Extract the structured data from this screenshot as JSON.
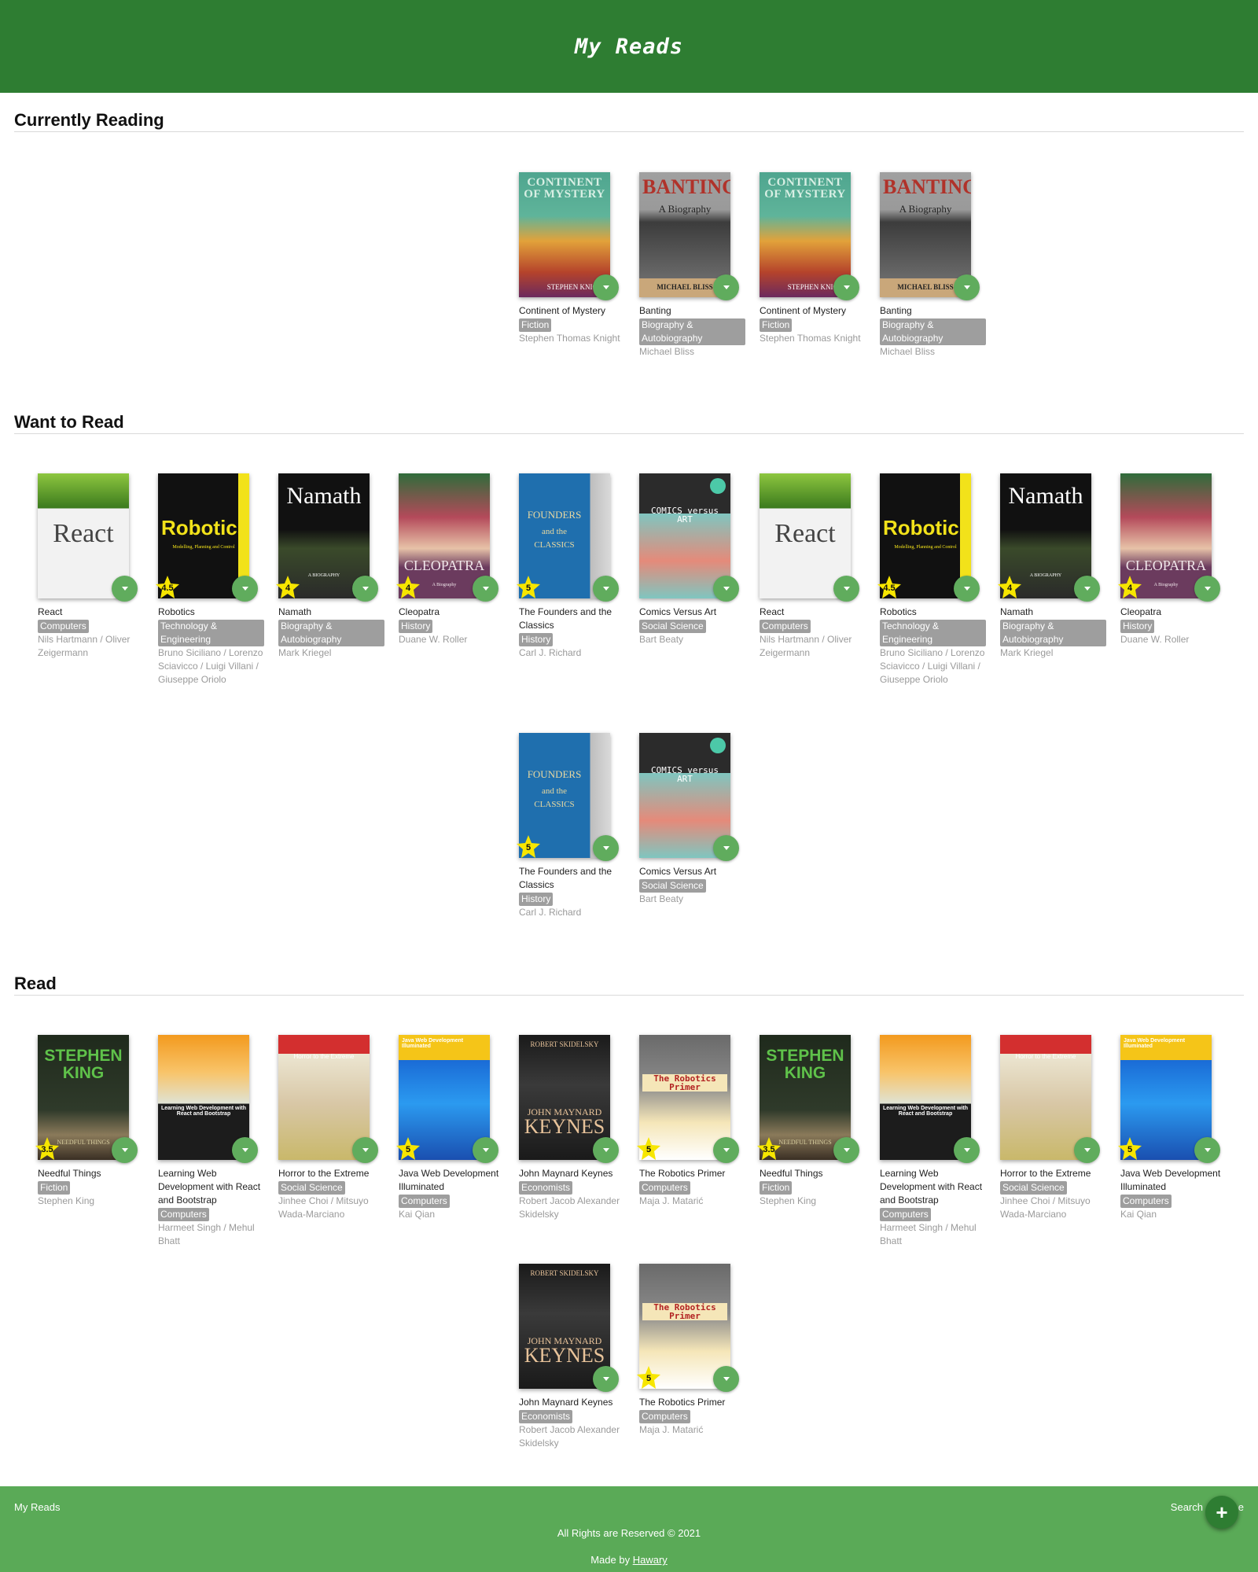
{
  "header": {
    "title": "My Reads"
  },
  "shelves": [
    {
      "title": "Currently Reading",
      "books": [
        {
          "title": "Continent of Mystery",
          "category": "Fiction",
          "author": "Stephen Thomas Knight",
          "cover": "continent",
          "rating": null
        },
        {
          "title": "Banting",
          "category": "Biography & Autobiography",
          "author": "Michael Bliss",
          "cover": "banting",
          "rating": null
        },
        {
          "title": "Continent of Mystery",
          "category": "Fiction",
          "author": "Stephen Thomas Knight",
          "cover": "continent",
          "rating": null
        },
        {
          "title": "Banting",
          "category": "Biography & Autobiography",
          "author": "Michael Bliss",
          "cover": "banting",
          "rating": null
        }
      ]
    },
    {
      "title": "Want to Read",
      "books": [
        {
          "title": "React",
          "category": "Computers",
          "author": "Nils Hartmann / Oliver Zeigermann",
          "cover": "react",
          "rating": null
        },
        {
          "title": "Robotics",
          "category": "Technology & Engineering",
          "author": "Bruno Siciliano / Lorenzo Sciavicco / Luigi Villani / Giuseppe Oriolo",
          "cover": "robotics",
          "rating": "4.5"
        },
        {
          "title": "Namath",
          "category": "Biography & Autobiography",
          "author": "Mark Kriegel",
          "cover": "namath",
          "rating": "4"
        },
        {
          "title": "Cleopatra",
          "category": "History",
          "author": "Duane W. Roller",
          "cover": "cleopatra",
          "rating": "4"
        },
        {
          "title": "The Founders and the Classics",
          "category": "History",
          "author": "Carl J. Richard",
          "cover": "founders",
          "rating": "5"
        },
        {
          "title": "Comics Versus Art",
          "category": "Social Science",
          "author": "Bart Beaty",
          "cover": "comics",
          "rating": null
        },
        {
          "title": "React",
          "category": "Computers",
          "author": "Nils Hartmann / Oliver Zeigermann",
          "cover": "react",
          "rating": null
        },
        {
          "title": "Robotics",
          "category": "Technology & Engineering",
          "author": "Bruno Siciliano / Lorenzo Sciavicco / Luigi Villani / Giuseppe Oriolo",
          "cover": "robotics",
          "rating": "4.5"
        },
        {
          "title": "Namath",
          "category": "Biography & Autobiography",
          "author": "Mark Kriegel",
          "cover": "namath",
          "rating": "4"
        },
        {
          "title": "Cleopatra",
          "category": "History",
          "author": "Duane W. Roller",
          "cover": "cleopatra",
          "rating": "4"
        },
        {
          "title": "The Founders and the Classics",
          "category": "History",
          "author": "Carl J. Richard",
          "cover": "founders",
          "rating": "5"
        },
        {
          "title": "Comics Versus Art",
          "category": "Social Science",
          "author": "Bart Beaty",
          "cover": "comics",
          "rating": null
        }
      ]
    },
    {
      "title": "Read",
      "books": [
        {
          "title": "Needful Things",
          "category": "Fiction",
          "author": "Stephen King",
          "cover": "needful",
          "rating": "3.5"
        },
        {
          "title": "Learning Web Development with React and Bootstrap",
          "category": "Computers",
          "author": "Harmeet Singh / Mehul Bhatt",
          "cover": "learning",
          "rating": null
        },
        {
          "title": "Horror to the Extreme",
          "category": "Social Science",
          "author": "Jinhee Choi / Mitsuyo Wada-Marciano",
          "cover": "horror",
          "rating": null
        },
        {
          "title": "Java Web Development Illuminated",
          "category": "Computers",
          "author": "Kai Qian",
          "cover": "java",
          "rating": "5"
        },
        {
          "title": "John Maynard Keynes",
          "category": "Economists",
          "author": "Robert Jacob Alexander Skidelsky",
          "cover": "keynes",
          "rating": null
        },
        {
          "title": "The Robotics Primer",
          "category": "Computers",
          "author": "Maja J. Matarić",
          "cover": "primer",
          "rating": "5"
        },
        {
          "title": "Needful Things",
          "category": "Fiction",
          "author": "Stephen King",
          "cover": "needful",
          "rating": "3.5"
        },
        {
          "title": "Learning Web Development with React and Bootstrap",
          "category": "Computers",
          "author": "Harmeet Singh / Mehul Bhatt",
          "cover": "learning",
          "rating": null
        },
        {
          "title": "Horror to the Extreme",
          "category": "Social Science",
          "author": "Jinhee Choi / Mitsuyo Wada-Marciano",
          "cover": "horror",
          "rating": null
        },
        {
          "title": "Java Web Development Illuminated",
          "category": "Computers",
          "author": "Kai Qian",
          "cover": "java",
          "rating": "5"
        },
        {
          "title": "John Maynard Keynes",
          "category": "Economists",
          "author": "Robert Jacob Alexander Skidelsky",
          "cover": "keynes",
          "rating": null
        },
        {
          "title": "The Robotics Primer",
          "category": "Computers",
          "author": "Maja J. Matarić",
          "cover": "primer",
          "rating": "5"
        }
      ]
    }
  ],
  "covers": {
    "continent": {
      "text": "CONTINENT OF MYSTERY",
      "sub": "STEPHEN KNIGHT",
      "bg": "#4fa58f",
      "fg": "#d8efe4"
    },
    "banting": {
      "text": "BANTING",
      "sub": "A Biography",
      "author_line": "MICHAEL BLISS",
      "bg": "#8f8f8f",
      "fg": "#b0322a"
    },
    "react": {
      "text": "React",
      "bg": "#f2f2f2",
      "fg": "#333333",
      "accent": "#8dc63f"
    },
    "robotics": {
      "text": "Robotics",
      "sub": "Modelling, Planning and Control",
      "bg": "#111111",
      "fg": "#f2e21a",
      "accent": "#f2e21a"
    },
    "namath": {
      "text": "Namath",
      "sub": "A BIOGRAPHY",
      "bg": "#1b1b1b",
      "fg": "#ffffff"
    },
    "cleopatra": {
      "text": "CLEOPATRA",
      "sub": "A Biography",
      "bg": "#7a4a6a",
      "fg": "#f0e6ea"
    },
    "founders": {
      "text": "FOUNDERS",
      "sub": "and the CLASSICS",
      "bg": "#1f6fae",
      "fg": "#e8d8a0"
    },
    "comics": {
      "text": "COMICS versus ART",
      "bg": "#2b2b2b",
      "fg": "#ffffff",
      "accent": "#4cc9a8"
    },
    "needful": {
      "text": "STEPHEN KING",
      "sub": "NEEDFUL THINGS",
      "bg": "#1f2a1c",
      "fg": "#5fc24a"
    },
    "learning": {
      "text": "Learning Web Development with React and Bootstrap",
      "bg": "#1c1c1c",
      "fg": "#ffffff",
      "accent": "#f39a1e"
    },
    "horror": {
      "text": "Horror to the Extreme",
      "bg": "#e8e4d0",
      "fg": "#ffffff",
      "accent": "#d32f2f"
    },
    "java": {
      "text": "Java Web Development Illuminated",
      "bg": "#1a6bd6",
      "fg": "#ffffff",
      "accent": "#f5c518"
    },
    "keynes": {
      "text": "KEYNES",
      "sub": "JOHN MAYNARD",
      "top": "ROBERT SKIDELSKY",
      "bg": "#1a1a1a",
      "fg": "#e8c39a",
      "accent": "#c0392b"
    },
    "primer": {
      "text": "The Robotics Primer",
      "bg": "#7a7a7a",
      "fg": "#b22222",
      "accent": "#f5e6b8"
    }
  },
  "footer": {
    "brand": "My Reads",
    "search": "Search",
    "trailing": "e",
    "copyright": "All Rights are Reserved © 2021",
    "made_by_prefix": "Made by",
    "made_by_name": "Hawary"
  },
  "add_button": {
    "label": "+"
  },
  "colors": {
    "header": "#2e7d32",
    "footer": "#5aaa57",
    "changer": "#60ac5d",
    "category_badge": "#9e9e9e",
    "rating_star": "#f7e600"
  }
}
